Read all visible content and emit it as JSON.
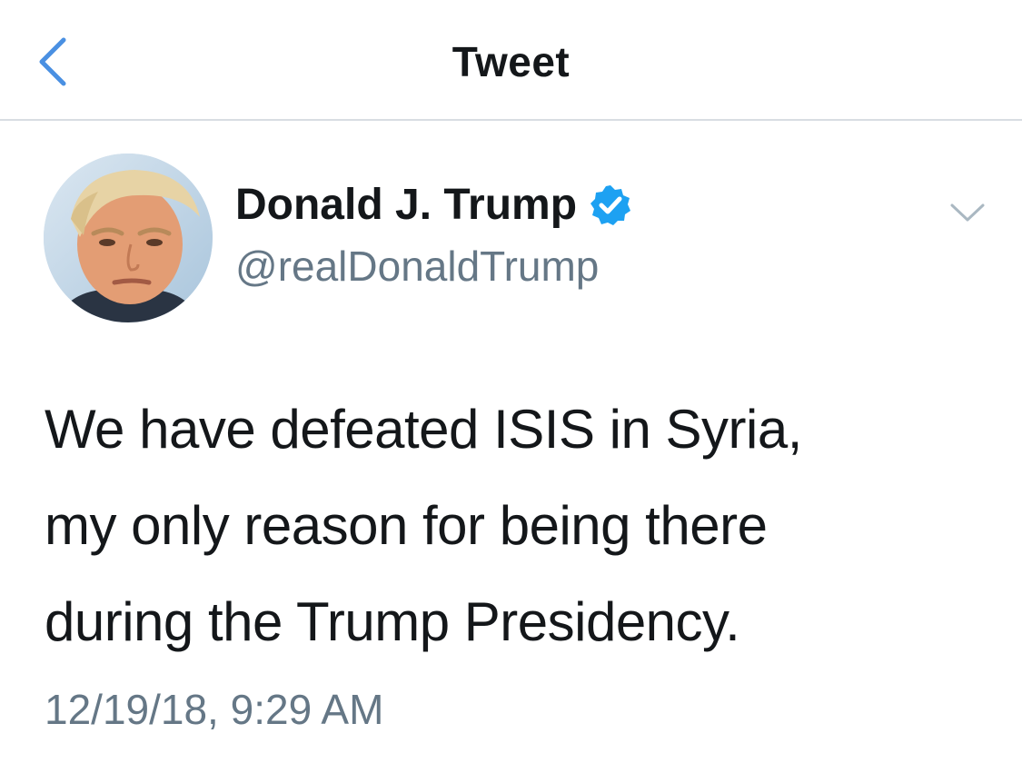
{
  "header": {
    "title": "Tweet",
    "back_icon": "chevron-left-icon"
  },
  "author": {
    "display_name": "Donald J. Trump",
    "handle": "@realDonaldTrump",
    "verified_icon": "verified-badge-icon",
    "avatar": "profile-photo"
  },
  "menu_icon": "chevron-down-icon",
  "tweet": {
    "lines": [
      "We have defeated ISIS in Syria,",
      "my only reason for being there",
      "during the Trump Presidency."
    ],
    "timestamp": "12/19/18, 9:29 AM"
  },
  "colors": {
    "accent": "#4a90e2",
    "text_primary": "#14171a",
    "text_secondary": "#657786",
    "divider": "#d8dde2",
    "verified": "#1da1f2"
  }
}
